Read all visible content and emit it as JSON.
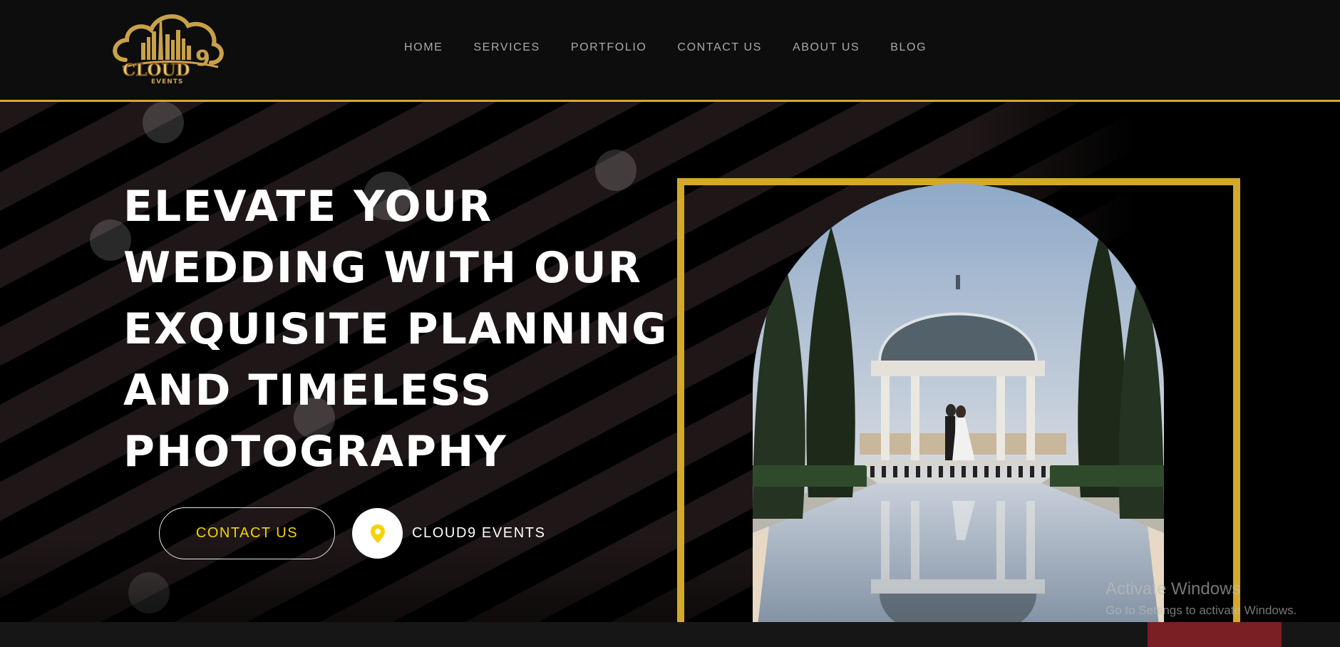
{
  "brand": {
    "logo_word": "CLOUD",
    "logo_nine": "9",
    "logo_sub": "EVENTS"
  },
  "nav": {
    "items": [
      {
        "label": "HOME"
      },
      {
        "label": "SERVICES"
      },
      {
        "label": "PORTFOLIO"
      },
      {
        "label": "CONTACT US"
      },
      {
        "label": "ABOUT US"
      },
      {
        "label": "BLOG"
      }
    ]
  },
  "hero": {
    "headline_lines": [
      "ELEVATE YOUR",
      "WEDDING WITH OUR",
      "EXQUISITE PLANNING",
      "AND TIMELESS",
      "PHOTOGRAPHY"
    ],
    "cta_label": "CONTACT US",
    "location_icon": "map-pin-icon",
    "brand_name": "CLOUD9 EVENTS"
  },
  "watermark": {
    "title": "Activate Windows",
    "subtitle": "Go to Settings to activate Windows."
  },
  "colors": {
    "accent_gold": "#d4a92a",
    "cta_text_yellow": "#f5d300",
    "header_bg": "#0d0d0d",
    "stripe_dark": "#1f1717"
  }
}
